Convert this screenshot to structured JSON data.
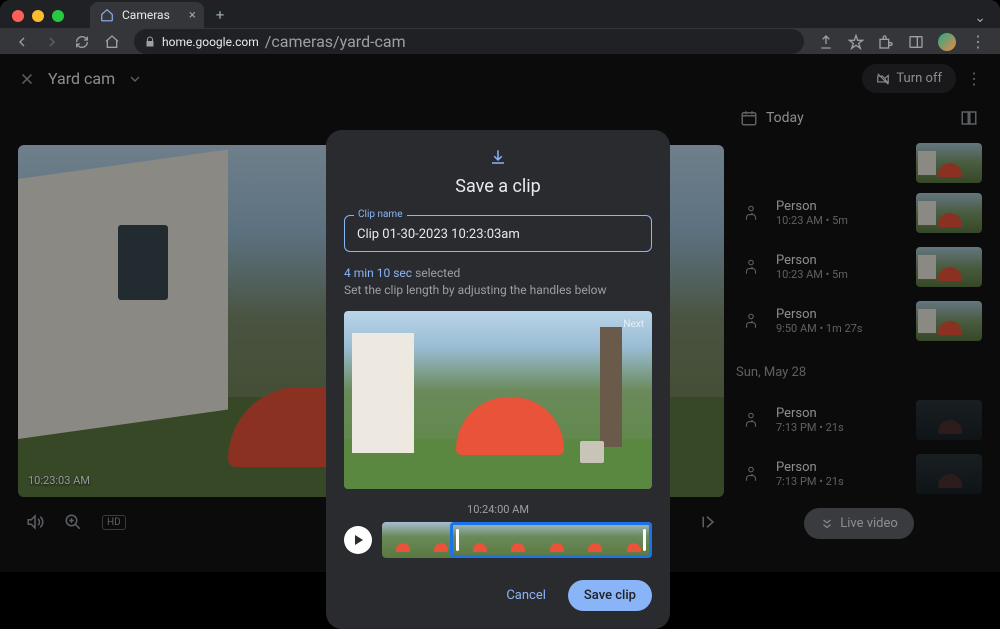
{
  "browser": {
    "tab_title": "Cameras",
    "url_host": "home.google.com",
    "url_path": "/cameras/yard-cam"
  },
  "header": {
    "page_title": "Yard cam",
    "turn_off": "Turn off"
  },
  "video": {
    "timestamp": "10:23:03 AM",
    "hd_badge": "HD"
  },
  "sidebar": {
    "today_label": "Today",
    "date_divider": "Sun, May 28",
    "live_label": "Live video",
    "events": [
      {
        "title": "Person",
        "sub": "10:23 AM • 5m",
        "dark": false
      },
      {
        "title": "Person",
        "sub": "10:23 AM • 5m",
        "dark": false
      },
      {
        "title": "Person",
        "sub": "9:50 AM • 1m 27s",
        "dark": false
      },
      {
        "title": "Person",
        "sub": "7:13 PM • 21s",
        "dark": true
      },
      {
        "title": "Person",
        "sub": "7:13 PM • 21s",
        "dark": true
      }
    ]
  },
  "dialog": {
    "title": "Save a clip",
    "field_label": "Clip name",
    "field_value": "Clip 01-30-2023 10:23:03am",
    "duration": "4 min 10 sec",
    "duration_sel": "selected",
    "hint": "Set the clip length by adjusting the handles below",
    "preview_badge": "Next",
    "timeline_label": "10:24:00 AM",
    "cancel": "Cancel",
    "save": "Save clip"
  }
}
